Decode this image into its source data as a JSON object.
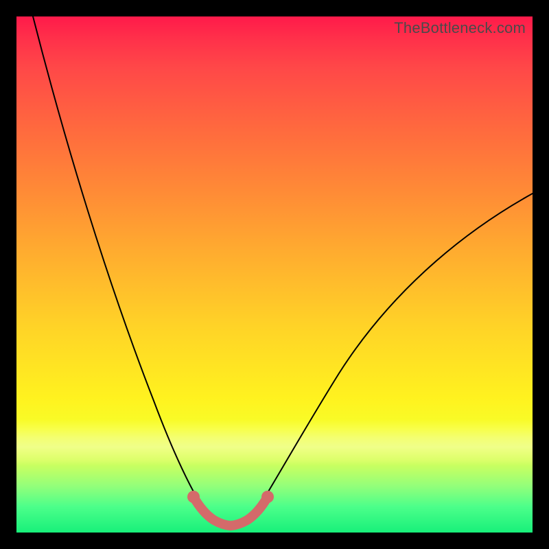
{
  "watermark": "TheBottleneck.com",
  "chart_data": {
    "type": "line",
    "title": "",
    "xlabel": "",
    "ylabel": "",
    "xlim": [
      0,
      100
    ],
    "ylim": [
      0,
      100
    ],
    "grid": false,
    "legend": false,
    "series": [
      {
        "name": "left-curve",
        "x": [
          3,
          6,
          10,
          14,
          18,
          22,
          26,
          30,
          33,
          36
        ],
        "values": [
          100,
          88,
          74,
          60,
          46,
          33,
          22,
          13,
          7,
          3
        ]
      },
      {
        "name": "right-curve",
        "x": [
          46,
          50,
          55,
          60,
          66,
          73,
          80,
          88,
          96,
          100
        ],
        "values": [
          3,
          7,
          14,
          22,
          31,
          40,
          48,
          56,
          63,
          66
        ]
      },
      {
        "name": "trough-highlight",
        "x": [
          34,
          36,
          38,
          40,
          42,
          44,
          46,
          48
        ],
        "values": [
          6,
          3,
          1.3,
          1,
          1,
          1.3,
          3,
          6
        ]
      }
    ],
    "gradient_stops": [
      {
        "pos": 0.0,
        "color": "#ff1a4a"
      },
      {
        "pos": 0.1,
        "color": "#ff4848"
      },
      {
        "pos": 0.34,
        "color": "#ff8b36"
      },
      {
        "pos": 0.6,
        "color": "#ffd327"
      },
      {
        "pos": 0.8,
        "color": "#f6ff2a"
      },
      {
        "pos": 0.95,
        "color": "#4cff8a"
      },
      {
        "pos": 1.0,
        "color": "#18f07a"
      }
    ],
    "highlight_color": "#d46a6a"
  }
}
